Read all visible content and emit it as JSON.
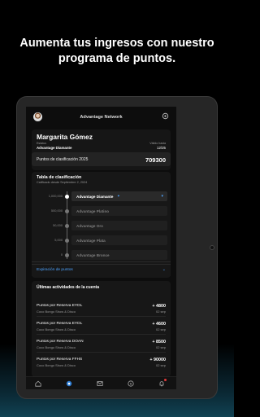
{
  "headline": {
    "line1": "Aumenta tus ingresos con nuestro",
    "line2": "programa de puntos."
  },
  "app": {
    "title": "Advantage Network",
    "profile": {
      "name": "Margarita Gómez",
      "status_label": "Estatus",
      "status_value": "Advantage Diamante",
      "valid_label": "Válido hasta",
      "valid_value": "12/25"
    },
    "points": {
      "label": "Puntos de clasificación 2025",
      "value": "709300"
    },
    "classification": {
      "title": "Tabla de clasificación",
      "subtitle": "Calificado desde Septiembre 2, 2024",
      "tiers": [
        {
          "threshold": "1,000,000",
          "name": "Advantage Diamante",
          "active": true
        },
        {
          "threshold": "500,000",
          "name": "Advantage Platino",
          "active": false
        },
        {
          "threshold": "50,000",
          "name": "Advantage Oro",
          "active": false
        },
        {
          "threshold": "5,000",
          "name": "Advantage Plata",
          "active": false
        },
        {
          "threshold": "0",
          "name": "Advantage Bronce",
          "active": false
        }
      ],
      "expanders": [
        {
          "label": "Información sobre estatus"
        },
        {
          "label": "Expiración de puntos"
        }
      ]
    },
    "activities": {
      "title": "Últimas actividades de la cuenta",
      "items": [
        {
          "name": "Puntos por Reserva EYDL",
          "venue": "Coco Bongo Show & Disco",
          "points": "+ 4800",
          "date": "02 sep"
        },
        {
          "name": "Puntos por Reserva EYDL",
          "venue": "Coco Bongo Show & Disco",
          "points": "+ 4600",
          "date": "02 sep"
        },
        {
          "name": "Puntos por Reserva DOAN",
          "venue": "Coco Bongo Show & Disco",
          "points": "+ 8500",
          "date": "02 sep"
        },
        {
          "name": "Puntos por Reserva FFHS",
          "venue": "Coco Bongo Show & Disco",
          "points": "+ 90000",
          "date": "02 sep"
        }
      ]
    },
    "nav": [
      {
        "icon": "home-icon"
      },
      {
        "icon": "points-icon"
      },
      {
        "icon": "mail-icon"
      },
      {
        "icon": "dollar-icon"
      },
      {
        "icon": "notifications-icon"
      }
    ],
    "colors": {
      "accent": "#4ea3ff",
      "background": "#0d0d0d"
    }
  }
}
